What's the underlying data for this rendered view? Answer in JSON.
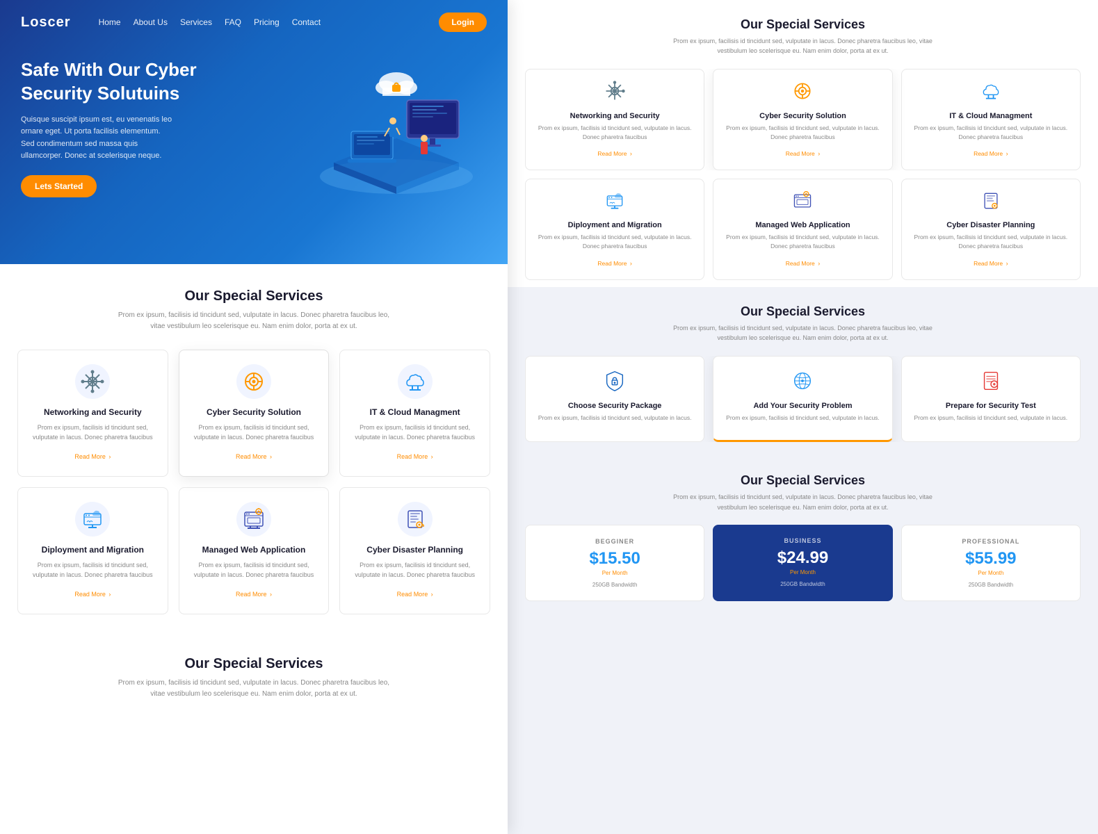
{
  "brand": {
    "logo": "Loscer"
  },
  "nav": {
    "links": [
      "Home",
      "About Us",
      "Services",
      "FAQ",
      "Pricing",
      "Contact"
    ],
    "cta": "Login"
  },
  "hero": {
    "title": "Safe With Our Cyber Security Solutuins",
    "description": "Quisque suscipit ipsum est, eu venenatis leo ornare eget. Ut porta facilisis elementum. Sed condimentum sed massa quis ullamcorper. Donec at scelerisque neque.",
    "cta": "Lets Started"
  },
  "services_section": {
    "title": "Our Special Services",
    "description": "Prom ex ipsum, facilisis id tincidunt sed, vulputate in lacus. Donec pharetra faucibus leo, vitae vestibulum leo scelerisque eu. Nam enim dolor, porta at ex ut.",
    "services": [
      {
        "name": "Networking and Security",
        "icon": "🔧",
        "icon_type": "network",
        "text": "Prom ex ipsum, facilisis id tincidunt sed, vulputate in lacus. Donec pharetra faucibus",
        "link": "Read More"
      },
      {
        "name": "Cyber Security Solution",
        "icon": "⚙️",
        "icon_type": "cyber",
        "text": "Prom ex ipsum, facilisis id tincidunt sed, vulputate in lacus. Donec pharetra faucibus",
        "link": "Read More"
      },
      {
        "name": "IT & Cloud Managment",
        "icon": "☁️",
        "icon_type": "cloud",
        "text": "Prom ex ipsum, facilisis id tincidunt sed, vulputate in lacus. Donec pharetra faucibus",
        "link": "Read More"
      },
      {
        "name": "Diployment and Migration",
        "icon": "🖥️",
        "icon_type": "deploy",
        "text": "Prom ex ipsum, facilisis id tincidunt sed, vulputate in lacus. Donec pharetra faucibus",
        "link": "Read More"
      },
      {
        "name": "Managed Web Application",
        "icon": "🖱️",
        "icon_type": "managed",
        "text": "Prom ex ipsum, facilisis id tincidunt sed, vulputate in lacus. Donec pharetra faucibus",
        "link": "Read More"
      },
      {
        "name": "Cyber Disaster Planning",
        "icon": "🏢",
        "icon_type": "disaster",
        "text": "Prom ex ipsum, facilisis id tincidunt sed, vulputate in lacus. Donec pharetra faucibus",
        "link": "Read More"
      }
    ]
  },
  "security_packages": {
    "title": "Our Special Services",
    "description": "Prom ex ipsum, facilisis id tincidunt sed, vulputate in lacus. Donec pharetra faucibus leo, vitae vestibulum leo scelerisque eu. Nam enim dolor, porta at ex ut.",
    "items": [
      {
        "name": "Choose Security Package",
        "icon": "🛡️",
        "text": "Prom ex ipsum, facilisis id tincidunt sed, vulputate in lacus.",
        "highlighted": false
      },
      {
        "name": "Add Your Security Problem",
        "icon": "🌐",
        "text": "Prom ex ipsum, facilisis id tincidunt sed, vulputate in lacus.",
        "highlighted": true
      },
      {
        "name": "Prepare for Security Test",
        "icon": "📋",
        "text": "Prom ex ipsum, facilisis id tincidunt sed, vulputate in lacus.",
        "highlighted": false
      }
    ]
  },
  "pricing": {
    "title": "Our Special Services",
    "description": "Prom ex ipsum, facilisis id tincidunt sed, vulputate in lacus. Donec pharetra faucibus leo, vitae vestibulum leo scelerisque eu. Nam enim dolor, porta at ex ut.",
    "plans": [
      {
        "name": "BEGGINER",
        "price": "$15.50",
        "period": "Per Month",
        "feature": "250GB Bandwidth",
        "featured": false
      },
      {
        "name": "BUSINESS",
        "price": "$24.99",
        "period": "Per Month",
        "feature": "250GB Bandwidth",
        "featured": true
      },
      {
        "name": "PROFESSIONAL",
        "price": "$55.99",
        "period": "Per Month",
        "feature": "250GB Bandwidth",
        "featured": false
      }
    ]
  },
  "right_services": {
    "title": "Our Special Services",
    "description": "Prom ex ipsum, facilisis id tincidunt sed, vulputate in lacus. Donec pharetra faucibus leo, vitae vestibulum leo scelerisque eu. Nam enim dolor, porta at ex ut.",
    "top_row": [
      {
        "name": "Networking and Security",
        "icon": "🔧",
        "text": "Prom ex ipsum, facilisis id tincidunt sed, vulputate in lacus. Donec pharetra faucibus",
        "link": "Read More",
        "partial": true
      },
      {
        "name": "Cyber Security Solution",
        "icon": "⚙️",
        "text": "Prom ex ipsum, facilisis id tincidunt sed, vulputate in lacus. Donec pharetra faucibus",
        "link": "Read More",
        "partial": false
      },
      {
        "name": "IT & Cloud Managment",
        "icon": "☁️",
        "text": "Prom ex ipsum, facilisis id tincidunt sed, vulputate in lacus. Donec pharetra faucibus",
        "link": "Read More",
        "partial": false
      }
    ],
    "bottom_row": [
      {
        "name": "Diployment and Migration",
        "icon": "🖥️",
        "text": "Prom ex ipsum, facilisis id tincidunt sed, vulputate in lacus. Donec pharetra faucibus",
        "link": "Read More",
        "partial": true
      },
      {
        "name": "Managed Web Application",
        "icon": "🖱️",
        "text": "Prom ex ipsum, facilisis id tincidunt sed, vulputate in lacus. Donec pharetra faucibus",
        "link": "Read More",
        "partial": false
      },
      {
        "name": "Cyber Disaster Planning",
        "icon": "🏢",
        "text": "Prom ex ipsum, facilisis id tincidunt sed, vulputate in lacus. Donec pharetra faucibus",
        "link": "Read More",
        "partial": false
      }
    ]
  }
}
